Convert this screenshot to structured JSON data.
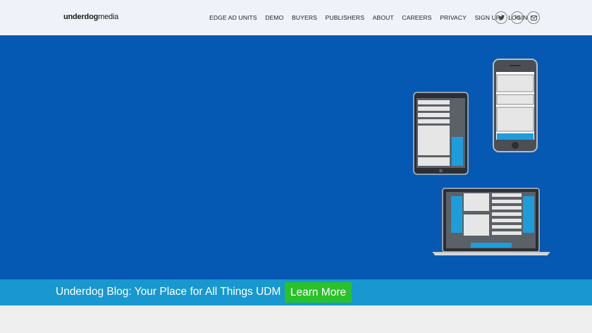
{
  "logo": {
    "bold": "underdog",
    "light": "media"
  },
  "nav": {
    "items": [
      "EDGE AD UNITS",
      "DEMO",
      "BUYERS",
      "PUBLISHERS",
      "ABOUT",
      "CAREERS",
      "PRIVACY",
      "SIGN UP",
      "LOGIN"
    ]
  },
  "social": {
    "icons": [
      "twitter-icon",
      "linkedin-icon",
      "mail-icon"
    ],
    "linkedin_text": "in"
  },
  "banner": {
    "text": "Underdog Blog: Your Place for All Things UDM",
    "button_label": "Learn More"
  },
  "colors": {
    "hero_bg": "#0659b2",
    "banner_bg": "#1898cf",
    "button_bg": "#2ac12a",
    "topbar_bg": "#eff2f8"
  }
}
